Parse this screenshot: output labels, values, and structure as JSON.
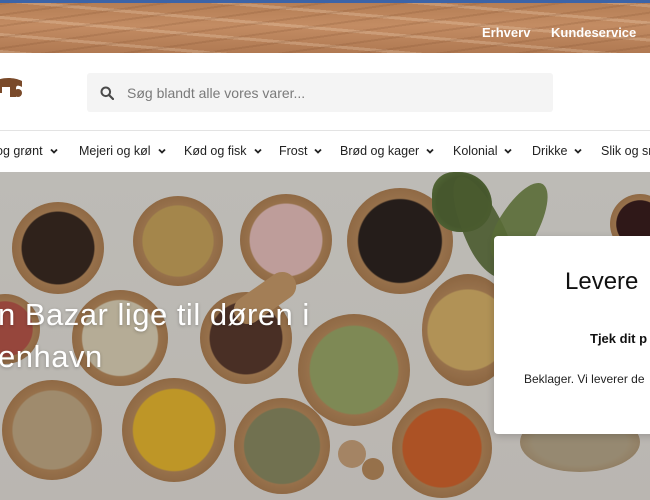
{
  "topbar": {
    "links": [
      {
        "label": "Erhverv"
      },
      {
        "label": "Kundeservice"
      }
    ]
  },
  "search": {
    "placeholder": "Søg blandt alle vores varer..."
  },
  "nav": {
    "items": [
      {
        "label": "og grønt"
      },
      {
        "label": "Mejeri og køl"
      },
      {
        "label": "Kød og fisk"
      },
      {
        "label": "Frost"
      },
      {
        "label": "Brød og kager"
      },
      {
        "label": "Kolonial"
      },
      {
        "label": "Drikke"
      },
      {
        "label": "Slik og sn"
      }
    ]
  },
  "hero": {
    "line1": "n Bazar lige til døren i",
    "line2": "enhavn"
  },
  "delivery_card": {
    "title": "Levere",
    "subtitle": "Tjek dit p",
    "message": "Beklager. Vi leverer de"
  },
  "colors": {
    "top_accent": "#3c64a8",
    "wood": "#b57e55",
    "white": "#ffffff"
  }
}
